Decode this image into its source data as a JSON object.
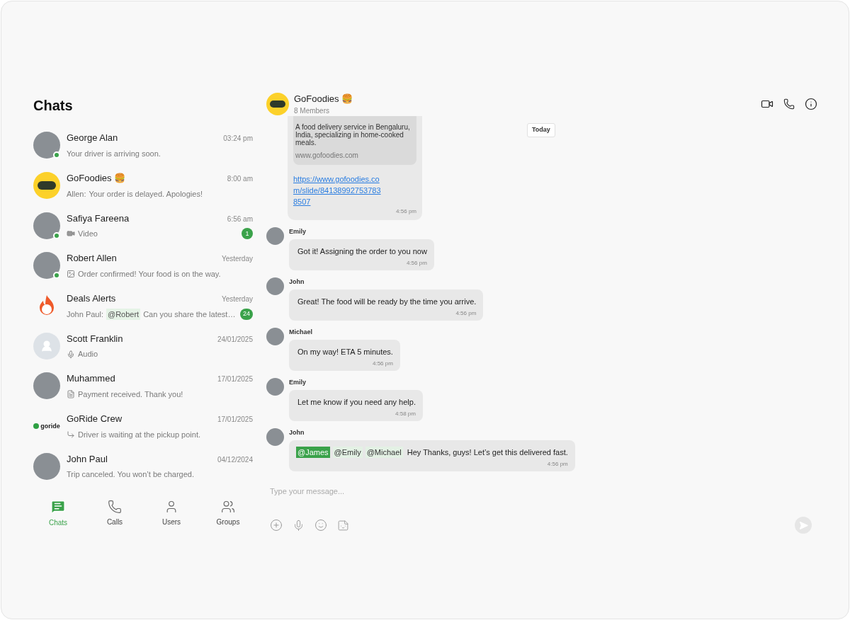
{
  "sidebar": {
    "title": "Chats",
    "items": [
      {
        "name": "George Alan",
        "time": "03:24 pm",
        "kind": "photo",
        "online": true,
        "preview": {
          "kind": "text",
          "text": "Your driver is arriving soon."
        }
      },
      {
        "name": "GoFoodies 🍔",
        "time": "8:00 am",
        "kind": "foodies",
        "online": false,
        "preview": {
          "kind": "text",
          "sender": "Allen:",
          "text": "Your order is delayed. Apologies!"
        }
      },
      {
        "name": "Safiya Fareena",
        "time": "6:56 am",
        "kind": "photo",
        "online": true,
        "unread": "1",
        "preview": {
          "kind": "video",
          "text": "Video"
        }
      },
      {
        "name": "Robert Allen",
        "time": "Yesterday",
        "kind": "photo",
        "online": true,
        "preview": {
          "kind": "image",
          "text": "Order confirmed! Your food is on the way."
        }
      },
      {
        "name": "Deals Alerts",
        "time": "Yesterday",
        "kind": "deal",
        "online": false,
        "unread": "24",
        "preview": {
          "kind": "text",
          "sender": "John Paul:",
          "mention": "@Robert",
          "text": "Can you share the latest…"
        }
      },
      {
        "name": "Scott Franklin",
        "time": "24/01/2025",
        "kind": "placeholder",
        "online": false,
        "preview": {
          "kind": "audio",
          "text": "Audio"
        }
      },
      {
        "name": "Muhammed",
        "time": "17/01/2025",
        "kind": "photo",
        "online": false,
        "preview": {
          "kind": "file",
          "text": "Payment received. Thank you!"
        }
      },
      {
        "name": "GoRide Crew",
        "time": "17/01/2025",
        "kind": "goride",
        "online": false,
        "logo": "goride",
        "preview": {
          "kind": "reply",
          "text": "Driver is waiting at the pickup point."
        }
      },
      {
        "name": "John Paul",
        "time": "04/12/2024",
        "kind": "photo",
        "online": false,
        "preview": {
          "kind": "text",
          "text": "Trip canceled. You won’t be charged."
        }
      }
    ]
  },
  "nav": [
    {
      "label": "Chats",
      "kind": "chats",
      "selected": true
    },
    {
      "label": "Calls",
      "kind": "calls",
      "selected": false
    },
    {
      "label": "Users",
      "kind": "users",
      "selected": false
    },
    {
      "label": "Groups",
      "kind": "groups",
      "selected": false
    }
  ],
  "chat": {
    "title": "GoFoodies 🍔",
    "subtitle": "8 Members",
    "link_message": {
      "description": " A food delivery service in Bengaluru, India, specializing in home-cooked meals.",
      "site": "www.gofoodies.com",
      "url": "https://www.gofoodies.com/slide/841389927537838507",
      "time": "4:56 pm"
    },
    "date_chip": "Today",
    "messages": [
      {
        "sender": "Emily",
        "time": "4:56 pm",
        "segments": [
          {
            "kind": "text",
            "text": "Got it! Assigning the order to you now"
          }
        ]
      },
      {
        "sender": "John",
        "time": "4:56 pm",
        "segments": [
          {
            "kind": "text",
            "text": "Great! The food will be ready by the time you arrive."
          }
        ]
      },
      {
        "sender": "Michael",
        "time": "4:56 pm",
        "segments": [
          {
            "kind": "text",
            "text": "On my way! ETA 5 minutes."
          }
        ]
      },
      {
        "sender": "Emily",
        "time": "4:58 pm",
        "segments": [
          {
            "kind": "text",
            "text": "Let me know if you need any help."
          }
        ]
      },
      {
        "sender": "John",
        "time": "4:56 pm",
        "segments": [
          {
            "kind": "mention",
            "self": true,
            "text": "@James"
          },
          {
            "kind": "mention",
            "self": false,
            "text": "@Emily"
          },
          {
            "kind": "mention",
            "self": false,
            "text": "@Michael"
          },
          {
            "kind": "text",
            "text": "Hey Thanks, guys! Let’s get this delivered fast."
          }
        ]
      }
    ],
    "composer": {
      "placeholder": "Type your message..."
    }
  }
}
